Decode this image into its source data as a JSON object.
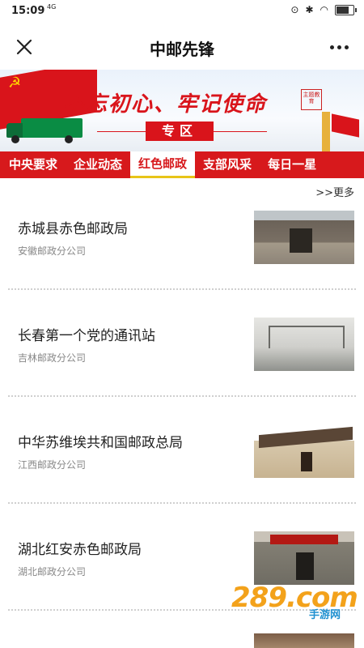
{
  "status_bar": {
    "time": "15:09",
    "network": "4G",
    "icons": [
      "alarm-icon",
      "bluetooth-icon",
      "wifi-icon",
      "battery-icon"
    ],
    "battery_level": 0.85
  },
  "nav": {
    "title": "中邮先锋",
    "close_icon": "close-icon",
    "more_icon": "more-icon"
  },
  "banner": {
    "slogan": "不忘初心、牢记使命",
    "zone_label": "专区",
    "seal_text": "主题教育"
  },
  "tabs": [
    {
      "label": "中央要求",
      "active": false
    },
    {
      "label": "企业动态",
      "active": false
    },
    {
      "label": "红色邮政",
      "active": true
    },
    {
      "label": "支部风采",
      "active": false
    },
    {
      "label": "每日一星",
      "active": false
    }
  ],
  "more_link": ">>更多",
  "items": [
    {
      "title": "赤城县赤色邮政局",
      "source": "安徽邮政分公司"
    },
    {
      "title": "长春第一个党的通讯站",
      "source": "吉林邮政分公司"
    },
    {
      "title": "中华苏维埃共和国邮政总局",
      "source": "江西邮政分公司"
    },
    {
      "title": "湖北红安赤色邮政局",
      "source": "湖北邮政分公司"
    }
  ],
  "watermark": {
    "main": "289.com",
    "sub": "手游网"
  },
  "colors": {
    "brand_red": "#d7191c",
    "tab_underline": "#e8c418",
    "watermark_orange": "#f3a21b",
    "watermark_blue": "#1e90d0"
  }
}
